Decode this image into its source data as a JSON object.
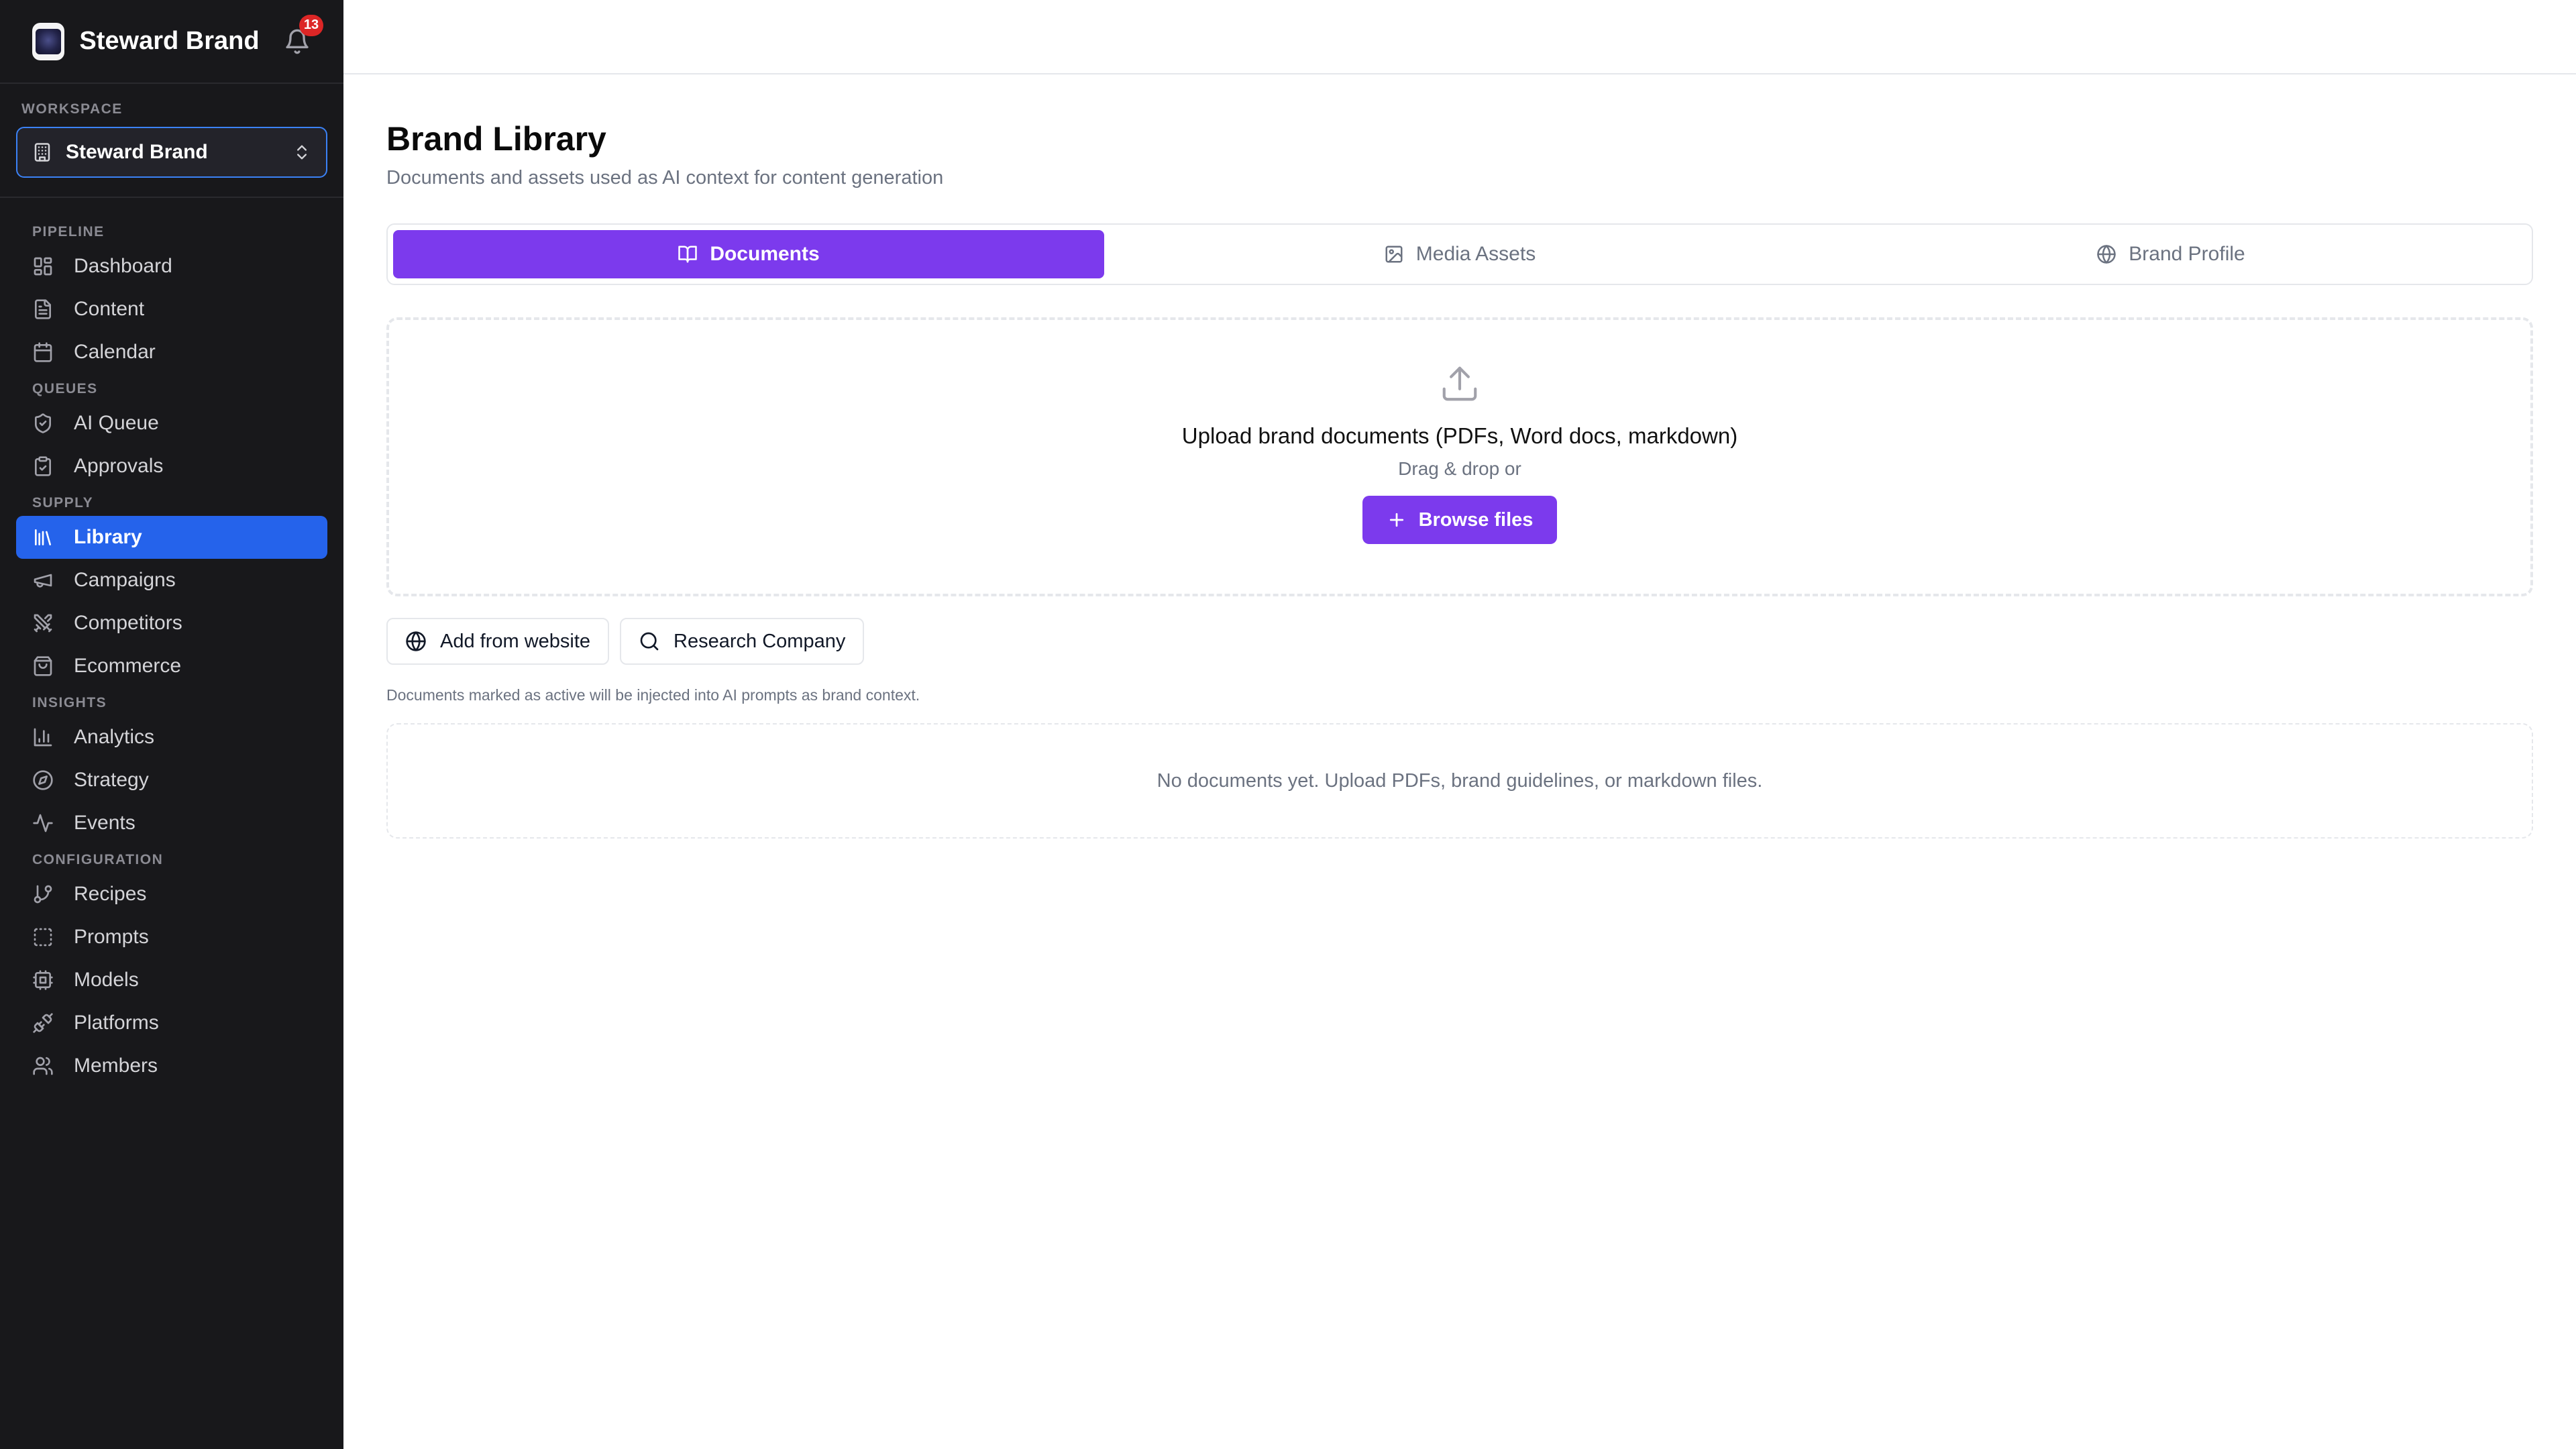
{
  "app": {
    "name": "Steward Brand",
    "notification_count": "13"
  },
  "workspace": {
    "label": "WORKSPACE",
    "selected": "Steward Brand"
  },
  "sidebar": {
    "sections": [
      {
        "label": "PIPELINE",
        "items": [
          {
            "label": "Dashboard",
            "icon": "layout-grid-icon"
          },
          {
            "label": "Content",
            "icon": "file-text-icon"
          },
          {
            "label": "Calendar",
            "icon": "calendar-icon"
          }
        ]
      },
      {
        "label": "QUEUES",
        "items": [
          {
            "label": "AI Queue",
            "icon": "shield-check-icon"
          },
          {
            "label": "Approvals",
            "icon": "clipboard-check-icon"
          }
        ]
      },
      {
        "label": "SUPPLY",
        "items": [
          {
            "label": "Library",
            "icon": "library-icon",
            "active": true
          },
          {
            "label": "Campaigns",
            "icon": "megaphone-icon"
          },
          {
            "label": "Competitors",
            "icon": "swords-icon"
          },
          {
            "label": "Ecommerce",
            "icon": "shopping-bag-icon"
          }
        ]
      },
      {
        "label": "INSIGHTS",
        "items": [
          {
            "label": "Analytics",
            "icon": "bar-chart-icon"
          },
          {
            "label": "Strategy",
            "icon": "compass-icon"
          },
          {
            "label": "Events",
            "icon": "activity-icon"
          }
        ]
      },
      {
        "label": "CONFIGURATION",
        "items": [
          {
            "label": "Recipes",
            "icon": "git-branch-icon"
          },
          {
            "label": "Prompts",
            "icon": "dashed-square-icon"
          },
          {
            "label": "Models",
            "icon": "cpu-icon"
          },
          {
            "label": "Platforms",
            "icon": "plug-icon"
          },
          {
            "label": "Members",
            "icon": "users-icon"
          }
        ]
      }
    ]
  },
  "page": {
    "title": "Brand Library",
    "subtitle": "Documents and assets used as AI context for content generation"
  },
  "tabs": [
    {
      "label": "Documents",
      "icon": "book-open-icon",
      "active": true
    },
    {
      "label": "Media Assets",
      "icon": "image-icon",
      "active": false
    },
    {
      "label": "Brand Profile",
      "icon": "globe-icon",
      "active": false
    }
  ],
  "upload": {
    "title": "Upload brand documents (PDFs, Word docs, markdown)",
    "subtitle": "Drag & drop or",
    "button": "Browse files"
  },
  "actions": {
    "add_from_website": "Add from website",
    "research_company": "Research Company"
  },
  "hint": "Documents marked as active will be injected into AI prompts as brand context.",
  "empty_state": "No documents yet. Upload PDFs, brand guidelines, or markdown files.",
  "colors": {
    "sidebar_bg": "#18181b",
    "nav_active": "#2563eb",
    "accent": "#7c3aed",
    "badge": "#dc2626"
  }
}
